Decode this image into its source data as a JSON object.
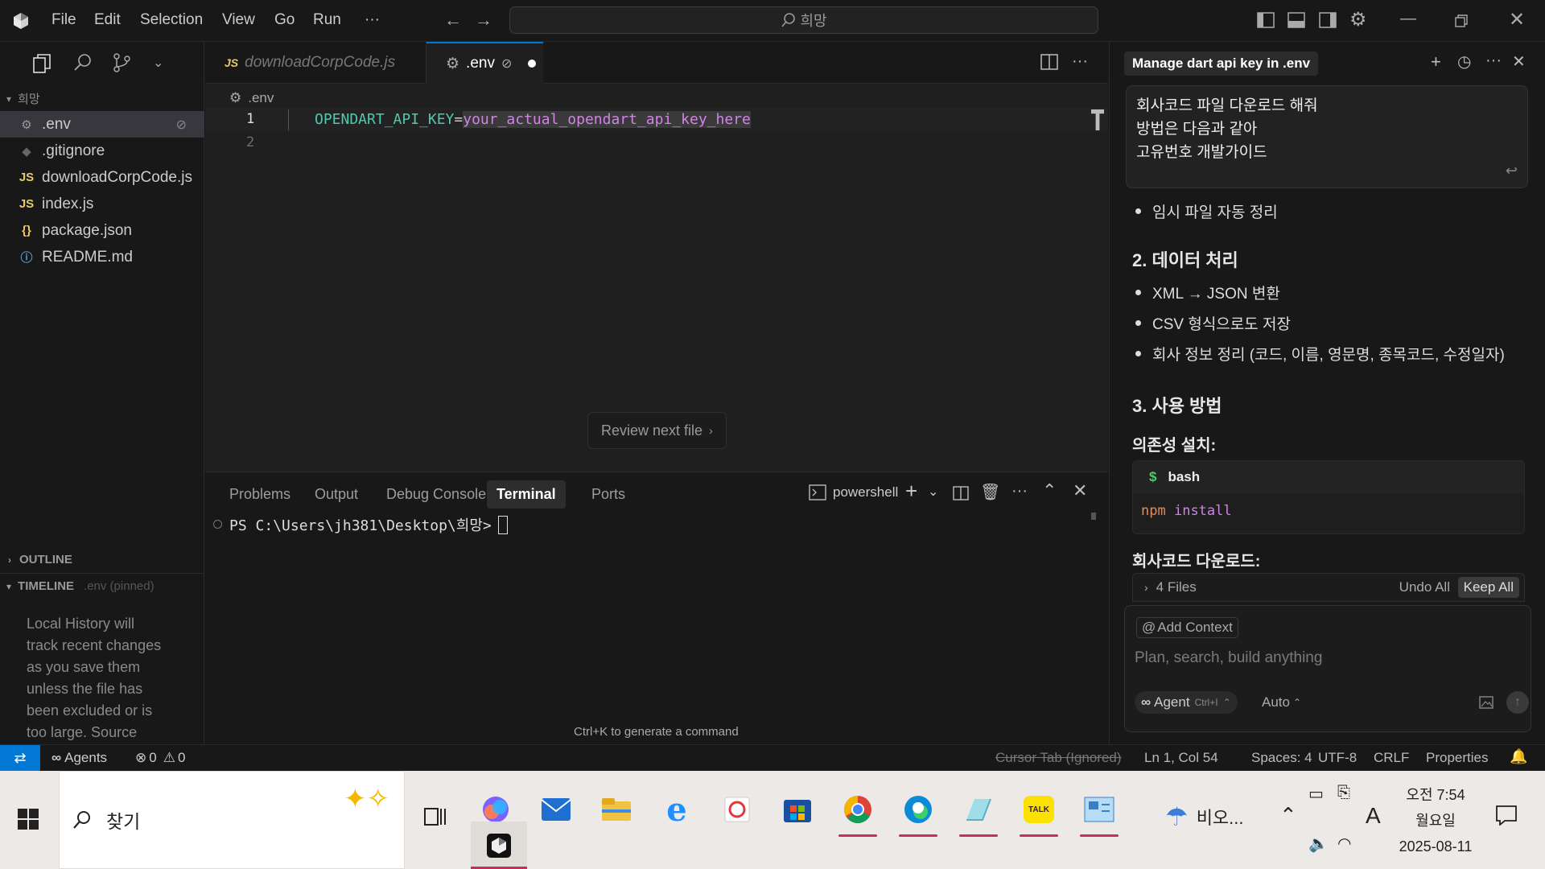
{
  "titlebar": {
    "menu": [
      "File",
      "Edit",
      "Selection",
      "View",
      "Go",
      "Run",
      "···"
    ],
    "search_text": "희망"
  },
  "explorer": {
    "folder": "희망",
    "files": [
      {
        "icon": "⚙",
        "name": ".env",
        "active": true
      },
      {
        "icon": "◆",
        "name": ".gitignore"
      },
      {
        "icon": "JS",
        "name": "downloadCorpCode.js"
      },
      {
        "icon": "JS",
        "name": "index.js"
      },
      {
        "icon": "{}",
        "name": "package.json"
      },
      {
        "icon": "ⓘ",
        "name": "README.md"
      }
    ],
    "outline": "OUTLINE",
    "timeline": "TIMELINE",
    "timeline_hint": ".env (pinned)",
    "history_text": [
      "Local History will",
      "track recent changes",
      "as you save them",
      "unless the file has",
      "been excluded or is",
      "too large. Source"
    ]
  },
  "tabs": {
    "tab1": "downloadCorpCode.js",
    "tab2": ".env"
  },
  "editor": {
    "breadcrumb": ".env",
    "line1_no": "1",
    "line2_no": "2",
    "key": "OPENDART_API_KEY",
    "eq": "=",
    "value": "your_actual_opendart_api_key_here",
    "review_btn": "Review next file"
  },
  "panel": {
    "tabs": [
      "Problems",
      "Output",
      "Debug Console",
      "Terminal",
      "Ports"
    ],
    "shell": "powershell",
    "prompt": "PS C:\\Users\\jh381\\Desktop\\희망>",
    "hint": "Ctrl+K to generate a command"
  },
  "chat": {
    "title": "Manage dart api key in .env",
    "user_msg": [
      "회사코드 파일 다운로드 해줘",
      "방법은 다음과 같아",
      "고유번호 개발가이드"
    ],
    "bullet_top": "임시 파일 자동 정리",
    "h_data": "2. 데이터 처리",
    "bullets_data": [
      "XML → JSON 변환",
      "CSV 형식으로도 저장",
      "회사 정보 정리 (코드, 이름, 영문명, 종목코드, 수정일자)"
    ],
    "h_usage": "3. 사용 방법",
    "dep_label": "의존성 설치:",
    "code_lang": "bash",
    "code_cmd": "npm",
    "code_arg": "install",
    "download_label": "회사코드 다운로드:",
    "files_count": "4 Files",
    "undo_all": "Undo All",
    "keep_all": "Keep All",
    "add_context": "Add Context",
    "input_placeholder": "Plan, search, build anything",
    "agent_label": "Agent",
    "agent_shortcut": "Ctrl+I",
    "auto_label": "Auto"
  },
  "status": {
    "agents": "Agents",
    "errors": "0",
    "warnings": "0",
    "cursor_tab": "Cursor Tab (Ignored)",
    "position": "Ln 1, Col 54",
    "spaces": "Spaces: 4",
    "encoding": "UTF-8",
    "eol": "CRLF",
    "properties": "Properties"
  },
  "taskbar": {
    "search_label": "찾기",
    "weather": "비오...",
    "ime": "A",
    "time": "오전 7:54",
    "weekday": "월요일",
    "date": "2025-08-11"
  },
  "colors": {
    "accent": "#0078d4",
    "key_green": "#4ec9b0",
    "value_pink": "#ce9178",
    "highlight_pink": "#d183e8"
  }
}
